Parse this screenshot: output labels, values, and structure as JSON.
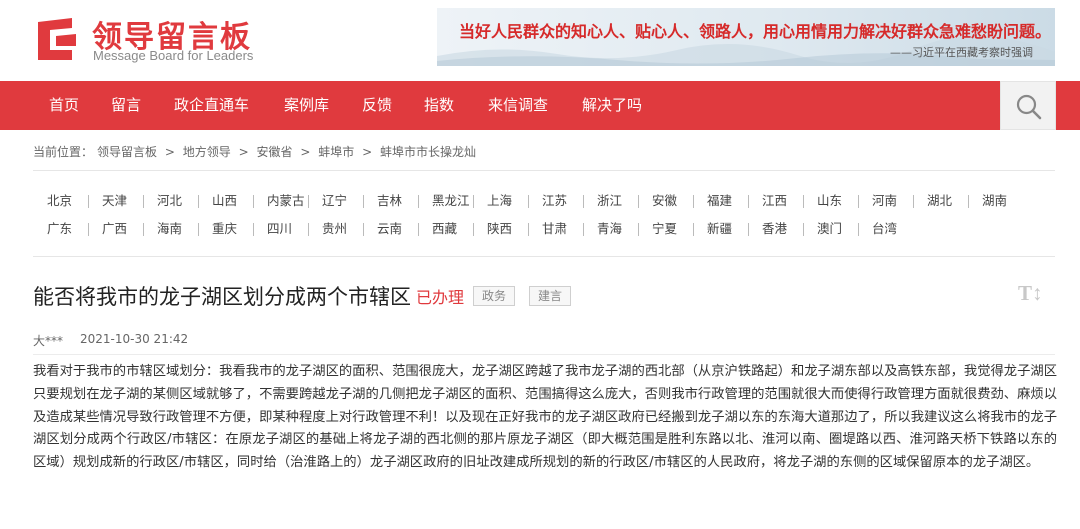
{
  "brand": {
    "title": "领导留言板",
    "subtitle": "Message Board for Leaders",
    "accent": "#e03a3e"
  },
  "banner": {
    "quote": "当好人民群众的知心人、贴心人、领路人，用心用情用力解决好群众急难愁盼问题。",
    "attribution": "——习近平在西藏考察时强调"
  },
  "nav": {
    "items": [
      "首页",
      "留言",
      "政企直通车",
      "案例库",
      "反馈",
      "指数",
      "来信调查",
      "解决了吗"
    ],
    "search_icon": "search-icon"
  },
  "breadcrumb": {
    "items": [
      "当前位置：",
      "领导留言板",
      ">",
      "地方领导",
      ">",
      "安徽省",
      ">",
      "蚌埠市",
      ">",
      "蚌埠市市长操龙灿"
    ]
  },
  "provinces": {
    "row1": [
      "北京",
      "天津",
      "河北",
      "山西",
      "内蒙古",
      "辽宁",
      "吉林",
      "黑龙江",
      "上海",
      "江苏",
      "浙江",
      "安徽",
      "福建",
      "江西",
      "山东",
      "河南",
      "湖北",
      "湖南"
    ],
    "row2": [
      "广东",
      "广西",
      "海南",
      "重庆",
      "四川",
      "贵州",
      "云南",
      "西藏",
      "陕西",
      "甘肃",
      "青海",
      "宁夏",
      "新疆",
      "香港",
      "澳门",
      "台湾"
    ]
  },
  "message": {
    "title": "能否将我市的龙子湖区划分成两个市辖区",
    "status": "已办理",
    "tags": [
      "政务",
      "建言"
    ],
    "font_toggle": "T↕",
    "author": "大***",
    "date": "2021-10-30 21:42",
    "content": "我看对于我市的市辖区域划分：我看我市的龙子湖区的面积、范围很庞大，龙子湖区跨越了我市龙子湖的西北部（从京沪铁路起）和龙子湖东部以及高铁东部，我觉得龙子湖区只要规划在龙子湖的某侧区域就够了，不需要跨越龙子湖的几侧把龙子湖区的面积、范围搞得这么庞大，否则我市行政管理的范围就很大而使得行政管理方面就很费劲、麻烦以及造成某些情况导致行政管理不方便，即某种程度上对行政管理不利！以及现在正好我市的龙子湖区政府已经搬到龙子湖以东的东海大道那边了，所以我建议这么将我市的龙子湖区划分成两个行政区/市辖区：在原龙子湖区的基础上将龙子湖的西北侧的那片原龙子湖区（即大概范围是胜利东路以北、淮河以南、圈堤路以西、淮河路天桥下铁路以东的区域）规划成新的行政区/市辖区，同时给（治淮路上的）龙子湖区政府的旧址改建成所规划的新的行政区/市辖区的人民政府，将龙子湖的东侧的区域保留原本的龙子湖区。"
  }
}
